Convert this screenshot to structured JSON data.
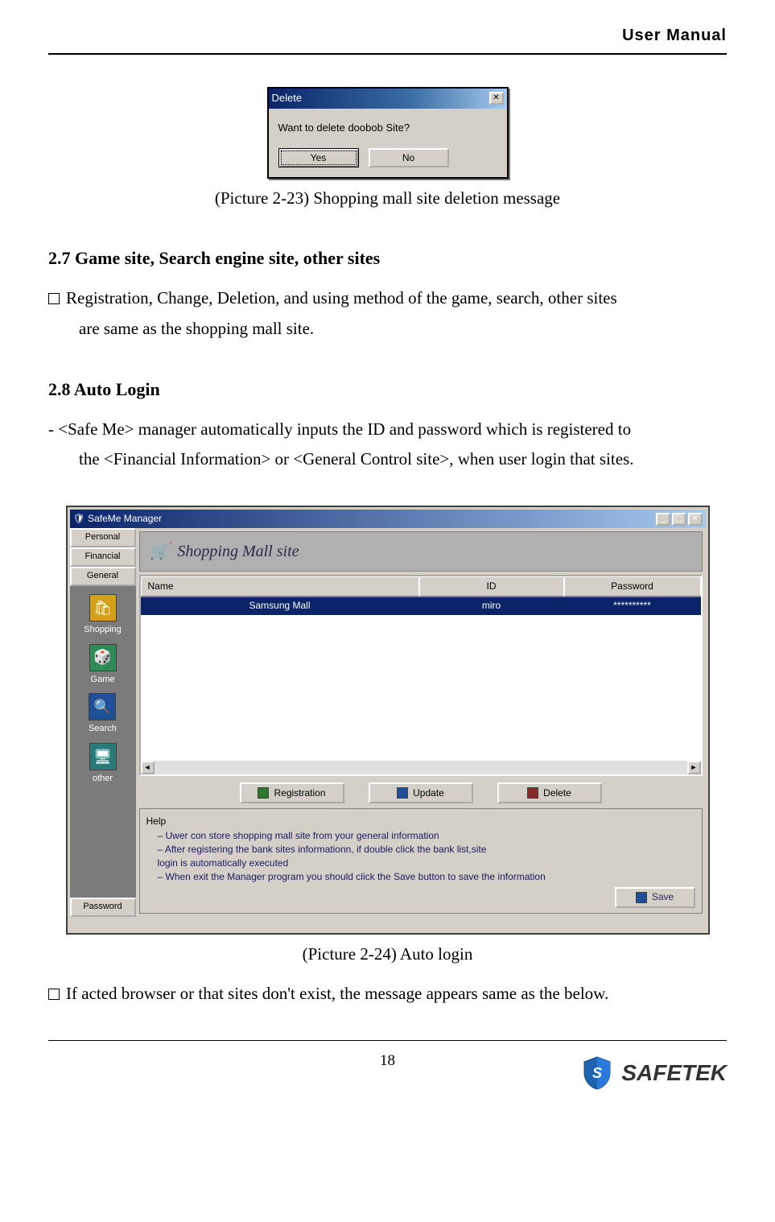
{
  "header_title": "User Manual",
  "dialog1": {
    "title": "Delete",
    "message": "Want to delete doobob Site?",
    "yes": "Yes",
    "no": "No"
  },
  "caption1": "(Picture 2-23) Shopping mall site deletion message",
  "section27": {
    "heading": "2.7 Game site, Search engine site, other sites",
    "body_lead": "Registration, Change, Deletion, and using method of the game, search, other sites",
    "body_tail": "are same as the shopping mall site."
  },
  "section28": {
    "heading": "2.8 Auto Login",
    "body_lead": "- <Safe Me> manager automatically inputs the ID and password which is registered to",
    "body_tail": "the <Financial Information> or <General Control site>, when user login that sites."
  },
  "smw": {
    "title": "SafeMe Manager",
    "side": {
      "tabs_top": [
        "Personal",
        "Financial",
        "General"
      ],
      "icons": [
        {
          "key": "Shopping",
          "glyph": "🛍"
        },
        {
          "key": "Game",
          "glyph": "🎲"
        },
        {
          "key": "Search",
          "glyph": "🔍"
        },
        {
          "key": "other",
          "glyph": "🖥"
        }
      ],
      "tab_bottom": "Password"
    },
    "banner": "Shopping Mall site",
    "table": {
      "headers": [
        "Name",
        "ID",
        "Password"
      ],
      "row": {
        "name": "Samsung Mall",
        "id": "miro",
        "pw": "**********"
      }
    },
    "actions": {
      "reg": "Registration",
      "upd": "Update",
      "del": "Delete"
    },
    "help": {
      "label": "Help",
      "lines": [
        "– Uwer con store shopping mall site from your general information",
        "– After registering the bank sites informationn, if double click the bank list,site",
        "   login is automatically executed",
        "– When exit the Manager program you should click the Save button to save the information"
      ]
    },
    "save": "Save"
  },
  "caption2": "(Picture 2-24) Auto login",
  "after_caption2": "If acted browser or that sites don't exist, the message appears same as the below.",
  "page_number": "18",
  "logo_text": "SAFETEK"
}
